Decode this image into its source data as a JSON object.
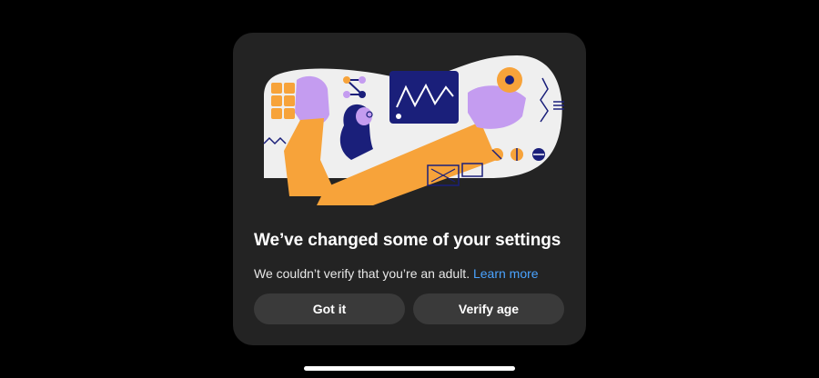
{
  "dialog": {
    "title": "We’ve changed some of your settings",
    "message": "We couldn’t verify that you’re an adult.",
    "learn_more_label": "Learn more",
    "got_it_label": "Got it",
    "verify_age_label": "Verify age"
  },
  "colors": {
    "background": "#000000",
    "sheet": "#232323",
    "button": "#3a3a3a",
    "link": "#4aa3ff",
    "illustration_orange": "#f7a33a",
    "illustration_purple": "#c49cf0",
    "illustration_navy": "#1a1f7a"
  },
  "icons": {
    "illustration": "person-with-chart-illustration"
  }
}
